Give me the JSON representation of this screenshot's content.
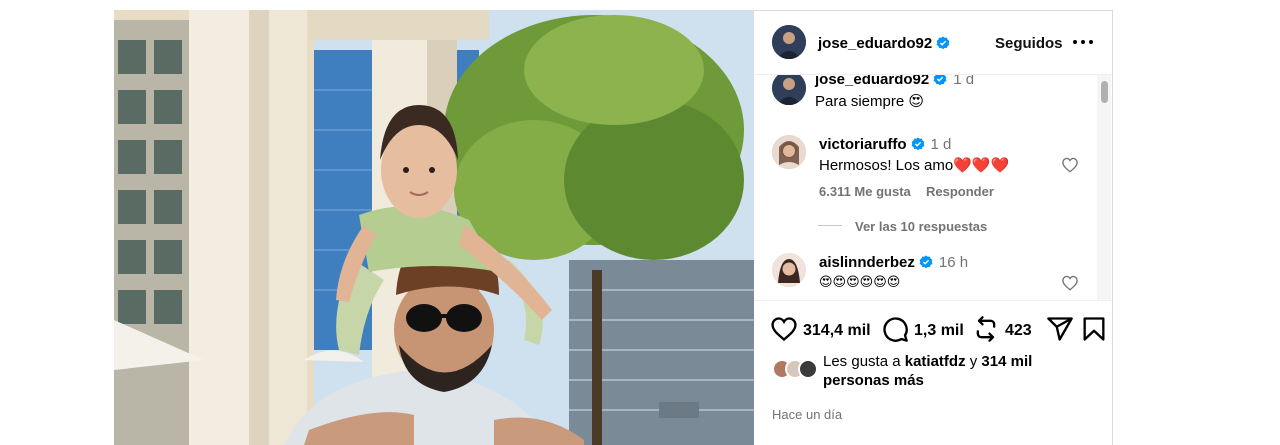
{
  "post": {
    "author": "jose_eduardo92",
    "follow_state": "Seguidos",
    "verified_color": "#0095f6"
  },
  "comments": [
    {
      "user": "jose_eduardo92",
      "time": "1 d",
      "text": "Para siempre 😍"
    },
    {
      "user": "victoriaruffo",
      "time": "1 d",
      "text": "Hermosos! Los amo❤️❤️❤️",
      "likes": "6.311 Me gusta",
      "reply": "Responder",
      "view_replies": "Ver las 10 respuestas"
    },
    {
      "user": "aislinnderbez",
      "time": "16 h",
      "text": "😍😍😍😍😍😍"
    }
  ],
  "actions": {
    "likes": "314,4 mil",
    "comments": "1,3 mil",
    "reposts": "423"
  },
  "liked_by": {
    "prefix": "Les gusta a",
    "user": "katiatfdz",
    "connector": "y",
    "count": "314 mil",
    "suffix": "personas más"
  },
  "timestamp": "Hace un día"
}
